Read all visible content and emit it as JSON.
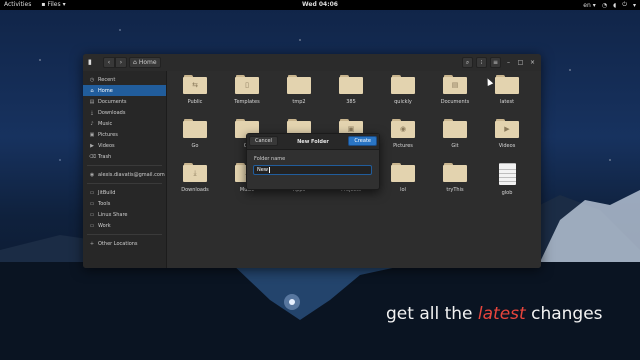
{
  "topbar": {
    "activities": "Activities",
    "app_menu": "Files",
    "app_menu_arrow": "▾",
    "clock": "Wed 04:06",
    "keyboard_layout": "en",
    "keyboard_arrow": "▾",
    "system_icons": [
      "network-icon",
      "volume-icon",
      "power-icon"
    ]
  },
  "window": {
    "breadcrumb": "Home",
    "nav_back": "‹",
    "nav_forward": "›",
    "header_icons": [
      "search-icon",
      "view-icon",
      "menu-icon"
    ],
    "window_controls": [
      "–",
      "□",
      "×"
    ]
  },
  "sidebar": {
    "items": [
      {
        "label": "Recent",
        "icon": "clock-icon",
        "glyph": "◷",
        "active": false
      },
      {
        "label": "Home",
        "icon": "home-icon",
        "glyph": "⌂",
        "active": true
      },
      {
        "label": "Documents",
        "icon": "documents-icon",
        "glyph": "▤",
        "active": false
      },
      {
        "label": "Downloads",
        "icon": "downloads-icon",
        "glyph": "⤓",
        "active": false
      },
      {
        "label": "Music",
        "icon": "music-icon",
        "glyph": "♪",
        "active": false
      },
      {
        "label": "Pictures",
        "icon": "pictures-icon",
        "glyph": "▣",
        "active": false
      },
      {
        "label": "Videos",
        "icon": "videos-icon",
        "glyph": "▶",
        "active": false
      },
      {
        "label": "Trash",
        "icon": "trash-icon",
        "glyph": "⌫",
        "active": false
      }
    ],
    "account": {
      "label": "alexis.diavatis@gmail.com",
      "icon": "account-icon",
      "glyph": "◉"
    },
    "bookmarks": [
      {
        "label": "JitBuild",
        "icon": "folder-icon",
        "glyph": "▭"
      },
      {
        "label": "Tools",
        "icon": "folder-icon",
        "glyph": "▭"
      },
      {
        "label": "Linux Share",
        "icon": "folder-icon",
        "glyph": "▭"
      },
      {
        "label": "Work",
        "icon": "folder-icon",
        "glyph": "▭"
      }
    ],
    "other_locations": {
      "label": "Other Locations",
      "glyph": "+"
    }
  },
  "files": [
    {
      "name": "Public",
      "kind": "folder",
      "glyph": "⇆"
    },
    {
      "name": "Templates",
      "kind": "folder",
      "glyph": "▯"
    },
    {
      "name": "tmp2",
      "kind": "folder",
      "glyph": ""
    },
    {
      "name": "385",
      "kind": "folder",
      "glyph": ""
    },
    {
      "name": "quickly",
      "kind": "folder",
      "glyph": ""
    },
    {
      "name": "Documents",
      "kind": "folder",
      "glyph": "▤"
    },
    {
      "name": "latest",
      "kind": "folder",
      "glyph": ""
    },
    {
      "name": "Go",
      "kind": "folder",
      "glyph": ""
    },
    {
      "name": "Co",
      "kind": "folder",
      "glyph": ""
    },
    {
      "name": "",
      "kind": "folder",
      "glyph": ""
    },
    {
      "name": "",
      "kind": "folder",
      "glyph": "▣"
    },
    {
      "name": "Pictures",
      "kind": "folder",
      "glyph": "◉"
    },
    {
      "name": "Git",
      "kind": "folder",
      "glyph": ""
    },
    {
      "name": "Videos",
      "kind": "folder",
      "glyph": "▶"
    },
    {
      "name": "Downloads",
      "kind": "folder",
      "glyph": "⤓"
    },
    {
      "name": "Music",
      "kind": "folder",
      "glyph": "♪"
    },
    {
      "name": "Apps",
      "kind": "folder",
      "glyph": ""
    },
    {
      "name": "Projects",
      "kind": "folder",
      "glyph": ""
    },
    {
      "name": "lol",
      "kind": "folder",
      "glyph": ""
    },
    {
      "name": "tryThis",
      "kind": "folder",
      "glyph": ""
    },
    {
      "name": "glob",
      "kind": "document",
      "glyph": ""
    }
  ],
  "dialog": {
    "title": "New Folder",
    "cancel": "Cancel",
    "create": "Create",
    "field_label": "Folder name",
    "field_value": "New"
  },
  "caption": {
    "before": "get all the ",
    "highlight": "latest",
    "after": " changes"
  },
  "colors": {
    "accent": "#215d9c",
    "create_button": "#2a75c4",
    "folder": "#e3d3af",
    "caption_highlight": "#e8453c"
  }
}
